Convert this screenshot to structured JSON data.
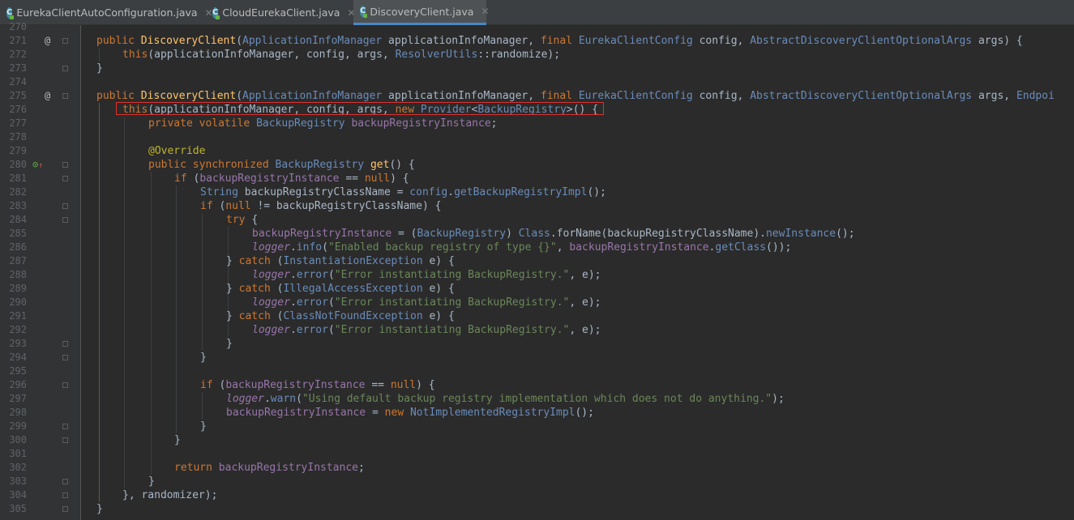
{
  "tabs": [
    {
      "label": "EurekaClientAutoConfiguration.java",
      "active": false
    },
    {
      "label": "CloudEurekaClient.java",
      "active": false
    },
    {
      "label": "DiscoveryClient.java",
      "active": true
    }
  ],
  "icons": {
    "file": "class-file-icon",
    "close": "close-icon"
  },
  "gutter": {
    "line_numbers": [
      "270",
      "271",
      "272",
      "273",
      "274",
      "275",
      "276",
      "277",
      "278",
      "279",
      "280",
      "281",
      "282",
      "283",
      "284",
      "285",
      "286",
      "287",
      "288",
      "289",
      "290",
      "291",
      "292",
      "293",
      "294",
      "295",
      "296",
      "297",
      "298",
      "299",
      "300",
      "301",
      "302",
      "303",
      "304",
      "305"
    ],
    "annotation_marker": "@"
  },
  "code_lines": [
    [],
    [
      [
        "kw",
        "public "
      ],
      [
        "fn",
        "DiscoveryClient"
      ],
      [
        "p",
        "("
      ],
      [
        "cls",
        "ApplicationInfoManager"
      ],
      [
        "p",
        " applicationInfoManager, "
      ],
      [
        "kw",
        "final "
      ],
      [
        "cls",
        "EurekaClientConfig"
      ],
      [
        "p",
        " config, "
      ],
      [
        "cls",
        "AbstractDiscoveryClientOptionalArgs"
      ],
      [
        "p",
        " args) {"
      ]
    ],
    [
      [
        "kw",
        "this"
      ],
      [
        "p",
        "(applicationInfoManager, config, args, "
      ],
      [
        "cls",
        "ResolverUtils"
      ],
      [
        "p",
        "::randomize);"
      ]
    ],
    [
      [
        "p",
        "}"
      ]
    ],
    [],
    [
      [
        "kw",
        "public "
      ],
      [
        "fn",
        "DiscoveryClient"
      ],
      [
        "p",
        "("
      ],
      [
        "cls",
        "ApplicationInfoManager"
      ],
      [
        "p",
        " applicationInfoManager, "
      ],
      [
        "kw",
        "final "
      ],
      [
        "cls",
        "EurekaClientConfig"
      ],
      [
        "p",
        " config, "
      ],
      [
        "cls",
        "AbstractDiscoveryClientOptionalArgs"
      ],
      [
        "p",
        " args, "
      ],
      [
        "cls",
        "Endpoi"
      ]
    ],
    [
      [
        "kw",
        "this"
      ],
      [
        "p",
        "(applicationInfoManager, config, args, "
      ],
      [
        "kw",
        "new "
      ],
      [
        "cls",
        "Provider"
      ],
      [
        "p",
        "<"
      ],
      [
        "cls",
        "BackupRegistry"
      ],
      [
        "p",
        ">() {"
      ]
    ],
    [
      [
        "kw",
        "private volatile "
      ],
      [
        "cls",
        "BackupRegistry"
      ],
      [
        "p",
        " "
      ],
      [
        "fld",
        "backupRegistryInstance"
      ],
      [
        "p",
        ";"
      ]
    ],
    [],
    [
      [
        "ann",
        "@Override"
      ]
    ],
    [
      [
        "kw",
        "public synchronized "
      ],
      [
        "cls",
        "BackupRegistry"
      ],
      [
        "p",
        " "
      ],
      [
        "fn",
        "get"
      ],
      [
        "p",
        "() {"
      ]
    ],
    [
      [
        "kw",
        "if "
      ],
      [
        "p",
        "("
      ],
      [
        "fld",
        "backupRegistryInstance"
      ],
      [
        "p",
        " == "
      ],
      [
        "kw",
        "null"
      ],
      [
        "p",
        ") {"
      ]
    ],
    [
      [
        "cls",
        "String"
      ],
      [
        "p",
        " backupRegistryClassName = "
      ],
      [
        "cls",
        "config"
      ],
      [
        "p",
        "."
      ],
      [
        "cls",
        "getBackupRegistryImpl"
      ],
      [
        "p",
        "();"
      ]
    ],
    [
      [
        "kw",
        "if "
      ],
      [
        "p",
        "("
      ],
      [
        "kw",
        "null"
      ],
      [
        "p",
        " != backupRegistryClassName) {"
      ]
    ],
    [
      [
        "kw",
        "try "
      ],
      [
        "p",
        "{"
      ]
    ],
    [
      [
        "fld",
        "backupRegistryInstance"
      ],
      [
        "p",
        " = ("
      ],
      [
        "cls",
        "BackupRegistry"
      ],
      [
        "p",
        ") "
      ],
      [
        "cls",
        "Class"
      ],
      [
        "p",
        ".forName(backupRegistryClassName)."
      ],
      [
        "cls",
        "newInstance"
      ],
      [
        "p",
        "();"
      ]
    ],
    [
      [
        "log",
        "logger"
      ],
      [
        "p",
        "."
      ],
      [
        "cls",
        "info"
      ],
      [
        "p",
        "("
      ],
      [
        "str",
        "\"Enabled backup registry of type {}\""
      ],
      [
        "p",
        ", "
      ],
      [
        "fld",
        "backupRegistryInstance"
      ],
      [
        "p",
        "."
      ],
      [
        "cls",
        "getClass"
      ],
      [
        "p",
        "());"
      ]
    ],
    [
      [
        "p",
        "} "
      ],
      [
        "kw",
        "catch "
      ],
      [
        "p",
        "("
      ],
      [
        "cls",
        "InstantiationException"
      ],
      [
        "p",
        " e) {"
      ]
    ],
    [
      [
        "log",
        "logger"
      ],
      [
        "p",
        "."
      ],
      [
        "cls",
        "error"
      ],
      [
        "p",
        "("
      ],
      [
        "str",
        "\"Error instantiating BackupRegistry.\""
      ],
      [
        "p",
        ", e);"
      ]
    ],
    [
      [
        "p",
        "} "
      ],
      [
        "kw",
        "catch "
      ],
      [
        "p",
        "("
      ],
      [
        "cls",
        "IllegalAccessException"
      ],
      [
        "p",
        " e) {"
      ]
    ],
    [
      [
        "log",
        "logger"
      ],
      [
        "p",
        "."
      ],
      [
        "cls",
        "error"
      ],
      [
        "p",
        "("
      ],
      [
        "str",
        "\"Error instantiating BackupRegistry.\""
      ],
      [
        "p",
        ", e);"
      ]
    ],
    [
      [
        "p",
        "} "
      ],
      [
        "kw",
        "catch "
      ],
      [
        "p",
        "("
      ],
      [
        "cls",
        "ClassNotFoundException"
      ],
      [
        "p",
        " e) {"
      ]
    ],
    [
      [
        "log",
        "logger"
      ],
      [
        "p",
        "."
      ],
      [
        "cls",
        "error"
      ],
      [
        "p",
        "("
      ],
      [
        "str",
        "\"Error instantiating BackupRegistry.\""
      ],
      [
        "p",
        ", e);"
      ]
    ],
    [
      [
        "p",
        "}"
      ]
    ],
    [
      [
        "p",
        "}"
      ]
    ],
    [],
    [
      [
        "kw",
        "if "
      ],
      [
        "p",
        "("
      ],
      [
        "fld",
        "backupRegistryInstance"
      ],
      [
        "p",
        " == "
      ],
      [
        "kw",
        "null"
      ],
      [
        "p",
        ") {"
      ]
    ],
    [
      [
        "log",
        "logger"
      ],
      [
        "p",
        "."
      ],
      [
        "cls",
        "warn"
      ],
      [
        "p",
        "("
      ],
      [
        "str",
        "\"Using default backup registry implementation which does not do anything.\""
      ],
      [
        "p",
        ");"
      ]
    ],
    [
      [
        "fld",
        "backupRegistryInstance"
      ],
      [
        "p",
        " = "
      ],
      [
        "kw",
        "new "
      ],
      [
        "cls",
        "NotImplementedRegistryImpl"
      ],
      [
        "p",
        "();"
      ]
    ],
    [
      [
        "p",
        "}"
      ]
    ],
    [
      [
        "p",
        "}"
      ]
    ],
    [],
    [
      [
        "kw",
        "return "
      ],
      [
        "fld",
        "backupRegistryInstance"
      ],
      [
        "p",
        ";"
      ]
    ],
    [
      [
        "p",
        "}"
      ]
    ],
    [
      [
        "p",
        "}, randomizer);"
      ]
    ],
    [
      [
        "p",
        "}"
      ]
    ]
  ],
  "colors": {
    "background": "#2b2b2b",
    "gutter": "#313335",
    "keyword": "#cc7832",
    "string": "#6a8759",
    "field": "#9876aa",
    "method": "#ffc66d",
    "annotation": "#bbb529",
    "highlight_box": "#e0302f",
    "active_tab_underline": "#4a88c7"
  }
}
